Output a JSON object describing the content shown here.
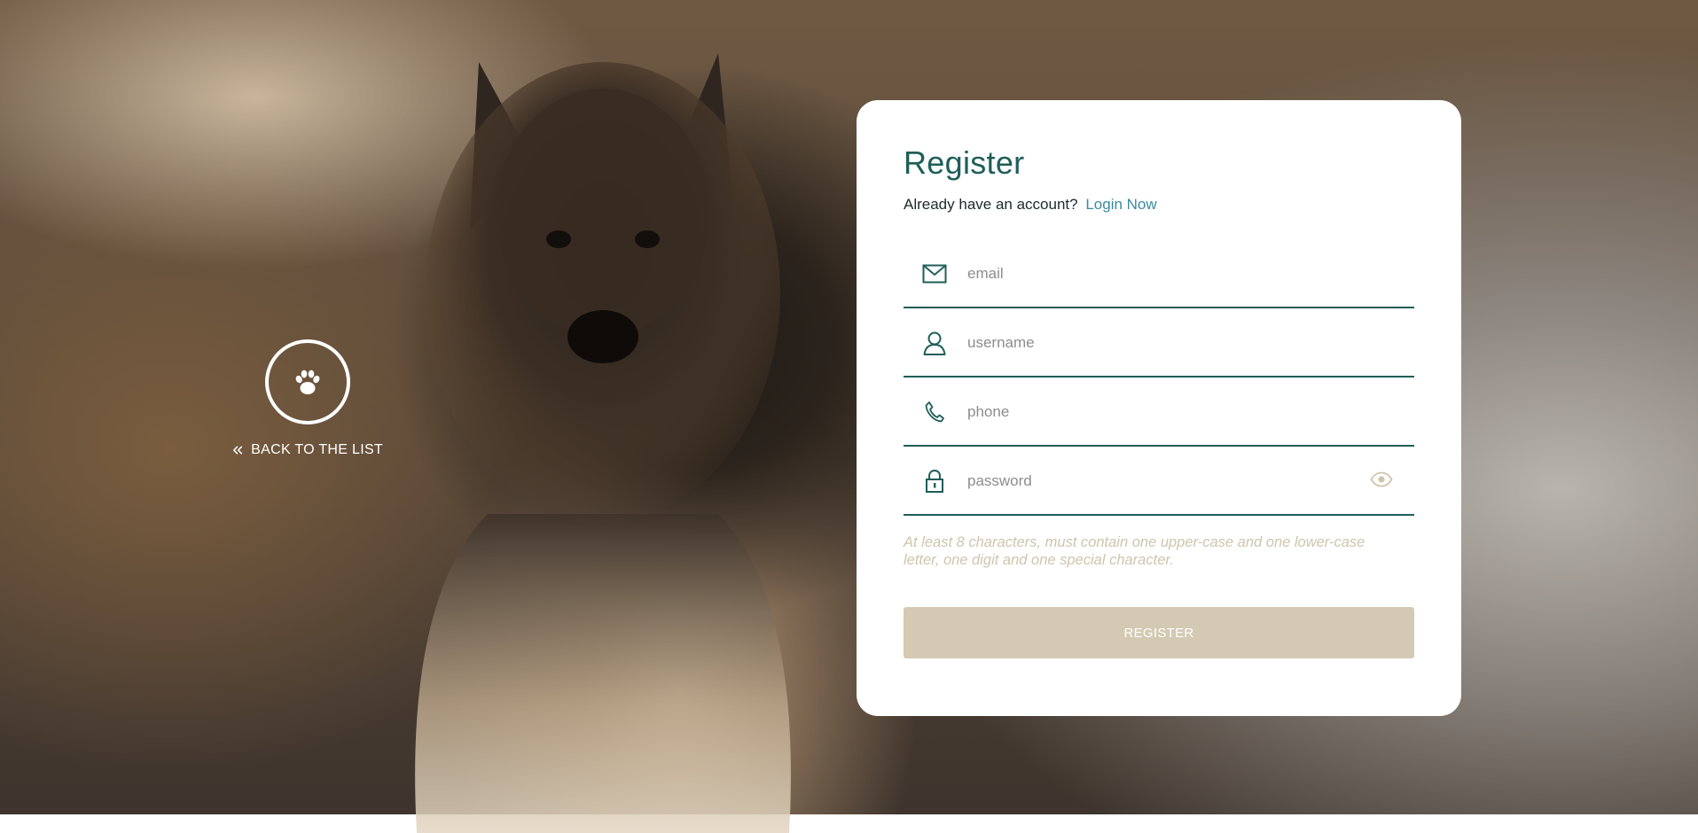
{
  "back": {
    "label": "BACK TO THE LIST"
  },
  "register": {
    "title": "Register",
    "prompt": "Already have an account?",
    "login_link": "Login Now",
    "fields": {
      "email_placeholder": "email",
      "username_placeholder": "username",
      "phone_placeholder": "phone",
      "password_placeholder": "password"
    },
    "password_hint": "At least 8 characters, must contain one upper-case and one lower-case letter, one digit and one special character.",
    "submit_label": "REGISTER"
  },
  "icons": {
    "back": "paw-icon",
    "back_arrow": "double-chevron-left-icon",
    "email": "envelope-icon",
    "username": "user-icon",
    "phone": "phone-icon",
    "password": "lock-icon",
    "toggle": "eye-icon"
  },
  "colors": {
    "accent": "#1f5e59",
    "link": "#3c8aa0",
    "button": "#d4cab3",
    "hint": "#cfc5ad"
  }
}
